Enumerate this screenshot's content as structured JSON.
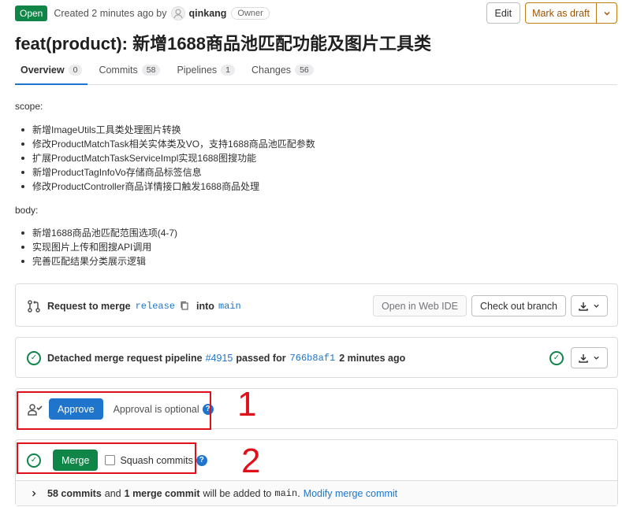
{
  "header": {
    "status": "Open",
    "created_text": "Created 2 minutes ago by",
    "author": "qinkang",
    "role_badge": "Owner",
    "edit_label": "Edit",
    "draft_label": "Mark as draft",
    "title": "feat(product): 新增1688商品池匹配功能及图片工具类"
  },
  "tabs": [
    {
      "label": "Overview",
      "count": "0"
    },
    {
      "label": "Commits",
      "count": "58"
    },
    {
      "label": "Pipelines",
      "count": "1"
    },
    {
      "label": "Changes",
      "count": "56"
    }
  ],
  "description": {
    "scope_heading": "scope:",
    "scope_items": [
      "新增ImageUtils工具类处理图片转换",
      "修改ProductMatchTask相关实体类及VO，支持1688商品池匹配参数",
      "扩展ProductMatchTaskServiceImpl实现1688图搜功能",
      "新增ProductTagInfoVo存储商品标签信息",
      "修改ProductController商品详情接口触发1688商品处理"
    ],
    "body_heading": "body:",
    "body_items": [
      "新增1688商品池匹配范围选项(4-7)",
      "实现图片上传和图搜API调用",
      "完善匹配结果分类展示逻辑"
    ]
  },
  "merge_request": {
    "prefix": "Request to merge",
    "source_branch": "release",
    "into": "into",
    "target_branch": "main",
    "web_ide_label": "Open in Web IDE",
    "checkout_label": "Check out branch"
  },
  "pipeline": {
    "prefix": "Detached merge request pipeline",
    "id": "#4915",
    "passed_for": "passed for",
    "commit": "766b8af1",
    "time": "2 minutes ago"
  },
  "approval": {
    "button_label": "Approve",
    "optional_text": "Approval is optional"
  },
  "merge": {
    "button_label": "Merge",
    "squash_label": "Squash commits",
    "commits_count": "58 commits",
    "and": "and",
    "merge_commit": "1 merge commit",
    "added_to": "will be added to",
    "branch": "main",
    "period": ".",
    "modify_link": "Modify merge commit"
  },
  "annotations": {
    "box1_label": "1",
    "box2_label": "2",
    "color": "#e0101a"
  }
}
